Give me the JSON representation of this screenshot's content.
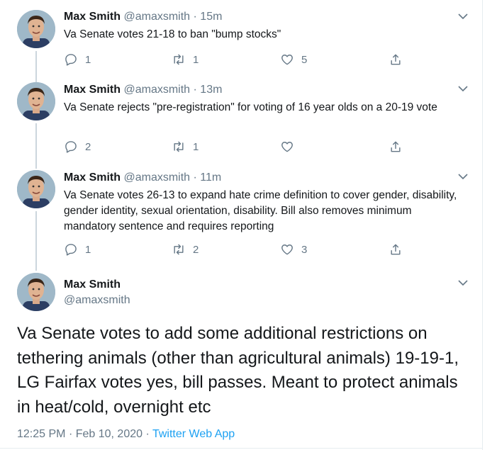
{
  "tweets": [
    {
      "name": "Max Smith",
      "handle": "@amaxsmith",
      "separator": "·",
      "time": "15m",
      "text": "Va Senate votes 21-18 to ban \"bump stocks\"",
      "replies": "1",
      "retweets": "1",
      "likes": "5"
    },
    {
      "name": "Max Smith",
      "handle": "@amaxsmith",
      "separator": "·",
      "time": "13m",
      "text": "Va Senate rejects \"pre-registration\" for voting of 16 year olds on a 20-19 vote",
      "replies": "2",
      "retweets": "1",
      "likes": ""
    },
    {
      "name": "Max Smith",
      "handle": "@amaxsmith",
      "separator": "·",
      "time": "11m",
      "text": "Va Senate votes 26-13 to expand hate crime definition to cover gender, disability, gender identity, sexual orientation, disability. Bill also removes minimum mandatory sentence and requires reporting",
      "replies": "1",
      "retweets": "2",
      "likes": "3"
    }
  ],
  "main_tweet": {
    "name": "Max Smith",
    "handle": "@amaxsmith",
    "text": "Va Senate votes to add some additional restrictions on tethering animals (other than agricultural animals) 19-19-1, LG Fairfax votes yes, bill passes. Meant to protect animals in heat/cold, overnight etc",
    "time": "12:25 PM",
    "separator": "·",
    "date": "Feb 10, 2020",
    "source": "Twitter Web App"
  },
  "colors": {
    "text": "#14171a",
    "secondary": "#657786",
    "link": "#1da1f2",
    "thread_line": "#ccd6dd"
  },
  "icons": [
    "reply-icon",
    "retweet-icon",
    "like-icon",
    "share-icon",
    "chevron-down-icon"
  ]
}
